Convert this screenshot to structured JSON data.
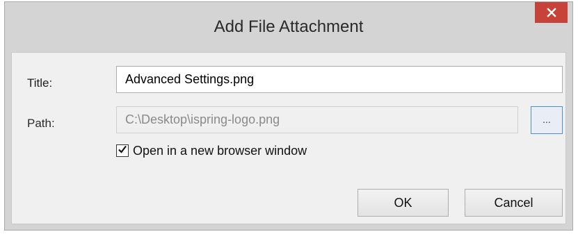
{
  "dialog": {
    "title": "Add File Attachment",
    "close_glyph": "close-icon",
    "close_color": "#c7433a"
  },
  "form": {
    "title_label": "Title:",
    "title_value": "Advanced Settings.png",
    "path_label": "Path:",
    "path_value": "C:\\Desktop\\ispring-logo.png",
    "browse_label": "...",
    "checkbox": {
      "label": "Open in a new browser window",
      "checked": true
    }
  },
  "buttons": {
    "ok_label": "OK",
    "cancel_label": "Cancel"
  }
}
